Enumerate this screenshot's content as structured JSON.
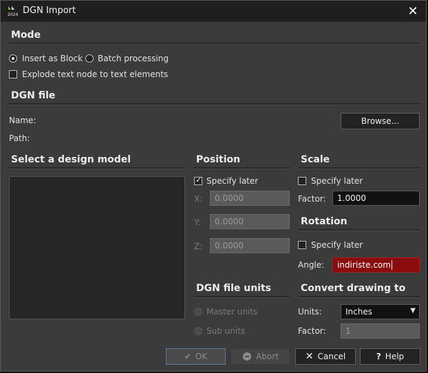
{
  "window": {
    "title": "DGN Import",
    "icon_text": "2024"
  },
  "mode": {
    "title": "Mode",
    "insert_as_block": "Insert as Block",
    "batch_processing": "Batch processing",
    "explode_text": "Explode text node to text elements"
  },
  "dgn_file": {
    "title": "DGN file",
    "name_label": "Name:",
    "path_label": "Path:",
    "browse": "Browse..."
  },
  "design_model": {
    "title": "Select a design model"
  },
  "position": {
    "title": "Position",
    "specify_later": "Specify later",
    "x_label": "X:",
    "y_label": "Y:",
    "z_label": "Z:",
    "x": "0.0000",
    "y": "0.0000",
    "z": "0.0000"
  },
  "scale": {
    "title": "Scale",
    "specify_later": "Specify later",
    "factor_label": "Factor:",
    "factor": "1.0000"
  },
  "rotation": {
    "title": "Rotation",
    "specify_later": "Specify later",
    "angle_label": "Angle:",
    "angle": "indiriste.com"
  },
  "dgn_units": {
    "title": "DGN file units",
    "master": "Master units",
    "sub": "Sub units"
  },
  "convert": {
    "title": "Convert drawing to",
    "units_label": "Units:",
    "units": "Inches",
    "factor_label": "Factor:",
    "factor": "1"
  },
  "buttons": {
    "ok": "OK",
    "abort": "Abort",
    "cancel": "Cancel",
    "help": "Help"
  },
  "colors": {
    "error_field": "#8b0c0c",
    "dialog_bg": "#3b3b3b",
    "title_bg": "#1f1f1f"
  }
}
